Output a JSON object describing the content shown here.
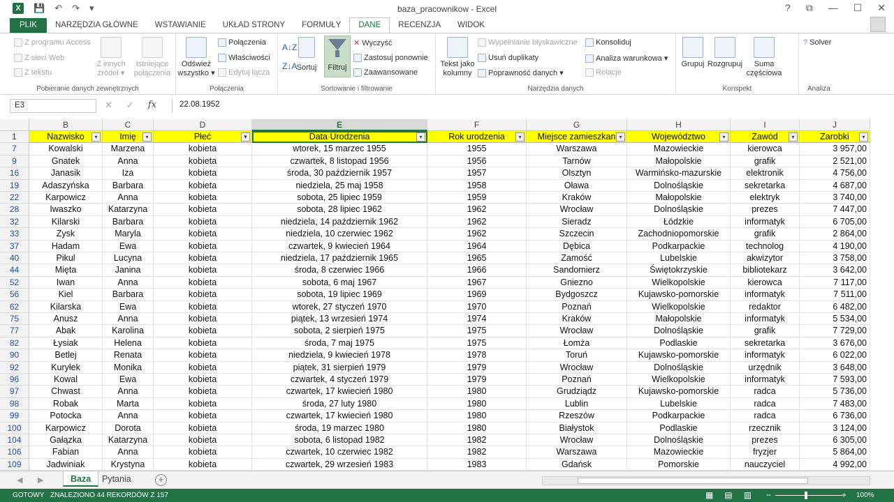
{
  "window": {
    "title": "baza_pracownikow - Excel",
    "logo": "X",
    "help": "?",
    "controls": [
      "⧉",
      "—",
      "☐",
      "✕"
    ]
  },
  "tabs": [
    "PLIK",
    "NARZĘDZIA GŁÓWNE",
    "WSTAWIANIE",
    "UKŁAD STRONY",
    "FORMUŁY",
    "DANE",
    "RECENZJA",
    "WIDOK"
  ],
  "active_tab": "DANE",
  "ribbon": {
    "external": {
      "access": "Z programu Access",
      "web": "Z sieci Web",
      "text": "Z tekstu",
      "other1": "Z innych",
      "other2": "źródeł ▾",
      "existing1": "Istniejące",
      "existing2": "połączenia",
      "label": "Pobieranie danych zewnętrznych"
    },
    "connections": {
      "refresh1": "Odśwież",
      "refresh2": "wszystko ▾",
      "conn": "Połączenia",
      "props": "Właściwości",
      "edit": "Edytuj łącza",
      "label": "Połączenia"
    },
    "sort": {
      "sort": "Sortuj",
      "filter": "Filtruj",
      "clear": "Wyczyść",
      "reapply": "Zastosuj ponownie",
      "advanced": "Zaawansowane",
      "label": "Sortowanie i filtrowanie"
    },
    "tools": {
      "text1": "Tekst jako",
      "text2": "kolumny",
      "flash": "Wypełnianie błyskawiczne",
      "dup": "Usuń duplikaty",
      "valid": "Poprawność danych ▾",
      "consol": "Konsoliduj",
      "whatif": "Analiza warunkowa ▾",
      "rel": "Relacje",
      "label": "Narzędzia danych"
    },
    "outline": {
      "group": "Grupuj",
      "ungroup": "Rozgrupuj",
      "subtotal1": "Suma",
      "subtotal2": "częściowa",
      "label": "Konspekt"
    },
    "analysis": {
      "solver": "Solver",
      "label": "Analiza"
    }
  },
  "formula_bar": {
    "name_box": "E3",
    "fx": "fx",
    "value": "22.08.1952"
  },
  "columns": [
    "B",
    "C",
    "D",
    "E",
    "F",
    "G",
    "H",
    "I",
    "J"
  ],
  "header_row_number": "1",
  "headers": [
    "Nazwisko",
    "Imię",
    "Płeć",
    "Data Urodzenia",
    "Rok urodzenia",
    "Miejsce zamieszkan",
    "Województwo",
    "Zawód",
    "Zarobki"
  ],
  "rows": [
    {
      "n": "7",
      "c": [
        "Kowalski",
        "Marzena",
        "kobieta",
        "wtorek, 15 marzec 1955",
        "1955",
        "Warszawa",
        "Mazowieckie",
        "kierowca",
        "3 957,00"
      ]
    },
    {
      "n": "9",
      "c": [
        "Gnatek",
        "Anna",
        "kobieta",
        "czwartek, 8 listopad 1956",
        "1956",
        "Tarnów",
        "Małopolskie",
        "grafik",
        "2 521,00"
      ]
    },
    {
      "n": "16",
      "c": [
        "Janasik",
        "Iza",
        "kobieta",
        "środa, 30 październik 1957",
        "1957",
        "Olsztyn",
        "Warmińsko-mazurskie",
        "elektronik",
        "4 756,00"
      ]
    },
    {
      "n": "19",
      "c": [
        "Adaszyńska",
        "Barbara",
        "kobieta",
        "niedziela, 25 maj 1958",
        "1958",
        "Oława",
        "Dolnośląskie",
        "sekretarka",
        "4 687,00"
      ]
    },
    {
      "n": "22",
      "c": [
        "Karpowicz",
        "Anna",
        "kobieta",
        "sobota, 25 lipiec 1959",
        "1959",
        "Kraków",
        "Małopolskie",
        "elektryk",
        "3 740,00"
      ]
    },
    {
      "n": "28",
      "c": [
        "Iwaszko",
        "Katarzyna",
        "kobieta",
        "sobota, 28 lipiec 1962",
        "1962",
        "Wrocław",
        "Dolnośląskie",
        "prezes",
        "7 447,00"
      ]
    },
    {
      "n": "32",
      "c": [
        "Kilarski",
        "Barbara",
        "kobieta",
        "niedziela, 14 październik 1962",
        "1962",
        "Sieradz",
        "Łódzkie",
        "informatyk",
        "6 705,00"
      ]
    },
    {
      "n": "33",
      "c": [
        "Zysk",
        "Maryla",
        "kobieta",
        "niedziela, 10 czerwiec 1962",
        "1962",
        "Szczecin",
        "Zachodniopomorskie",
        "grafik",
        "2 864,00"
      ]
    },
    {
      "n": "37",
      "c": [
        "Hadam",
        "Ewa",
        "kobieta",
        "czwartek, 9 kwiecień 1964",
        "1964",
        "Dębica",
        "Podkarpackie",
        "technolog",
        "4 190,00"
      ]
    },
    {
      "n": "40",
      "c": [
        "Pikul",
        "Lucyna",
        "kobieta",
        "niedziela, 17 październik 1965",
        "1965",
        "Zamość",
        "Lubelskie",
        "akwizytor",
        "3 758,00"
      ]
    },
    {
      "n": "44",
      "c": [
        "Mięta",
        "Janina",
        "kobieta",
        "środa, 8 czerwiec 1966",
        "1966",
        "Sandomierz",
        "Świętokrzyskie",
        "bibliotekarz",
        "3 642,00"
      ]
    },
    {
      "n": "52",
      "c": [
        "Iwan",
        "Anna",
        "kobieta",
        "sobota, 6 maj 1967",
        "1967",
        "Gniezno",
        "Wielkopolskie",
        "kierowca",
        "7 117,00"
      ]
    },
    {
      "n": "56",
      "c": [
        "Kiel",
        "Barbara",
        "kobieta",
        "sobota, 19 lipiec 1969",
        "1969",
        "Bydgoszcz",
        "Kujawsko-pomorskie",
        "informatyk",
        "7 511,00"
      ]
    },
    {
      "n": "62",
      "c": [
        "Kilarska",
        "Ewa",
        "kobieta",
        "wtorek, 27 styczeń 1970",
        "1970",
        "Poznań",
        "Wielkopolskie",
        "redaktor",
        "6 482,00"
      ]
    },
    {
      "n": "75",
      "c": [
        "Anusz",
        "Anna",
        "kobieta",
        "piątek, 13 wrzesień 1974",
        "1974",
        "Kraków",
        "Małopolskie",
        "informatyk",
        "5 534,00"
      ]
    },
    {
      "n": "77",
      "c": [
        "Abak",
        "Karolina",
        "kobieta",
        "sobota, 2 sierpień 1975",
        "1975",
        "Wrocław",
        "Dolnośląskie",
        "grafik",
        "7 729,00"
      ]
    },
    {
      "n": "82",
      "c": [
        "Łysiak",
        "Helena",
        "kobieta",
        "środa, 7 maj 1975",
        "1975",
        "Łomża",
        "Podlaskie",
        "sekretarka",
        "3 676,00"
      ]
    },
    {
      "n": "90",
      "c": [
        "Betlej",
        "Renata",
        "kobieta",
        "niedziela, 9 kwiecień 1978",
        "1978",
        "Toruń",
        "Kujawsko-pomorskie",
        "informatyk",
        "6 022,00"
      ]
    },
    {
      "n": "92",
      "c": [
        "Kuryłek",
        "Monika",
        "kobieta",
        "piątek, 31 sierpień 1979",
        "1979",
        "Wrocław",
        "Dolnośląskie",
        "urzędnik",
        "3 648,00"
      ]
    },
    {
      "n": "96",
      "c": [
        "Kowal",
        "Ewa",
        "kobieta",
        "czwartek, 4 styczeń 1979",
        "1979",
        "Poznań",
        "Wielkopolskie",
        "informatyk",
        "7 593,00"
      ]
    },
    {
      "n": "97",
      "c": [
        "Chwast",
        "Anna",
        "kobieta",
        "czwartek, 17 kwiecień 1980",
        "1980",
        "Grudziądz",
        "Kujawsko-pomorskie",
        "radca",
        "5 736,00"
      ]
    },
    {
      "n": "98",
      "c": [
        "Robak",
        "Marta",
        "kobieta",
        "środa, 27 luty 1980",
        "1980",
        "Lublin",
        "Lubelskie",
        "radca",
        "7 483,00"
      ]
    },
    {
      "n": "99",
      "c": [
        "Potocka",
        "Anna",
        "kobieta",
        "czwartek, 17 kwiecień 1980",
        "1980",
        "Rzeszów",
        "Podkarpackie",
        "radca",
        "6 736,00"
      ]
    },
    {
      "n": "100",
      "c": [
        "Karpowicz",
        "Dorota",
        "kobieta",
        "środa, 19 marzec 1980",
        "1980",
        "Białystok",
        "Podlaskie",
        "rzecznik",
        "3 124,00"
      ]
    },
    {
      "n": "104",
      "c": [
        "Gałązka",
        "Katarzyna",
        "kobieta",
        "sobota, 6 listopad 1982",
        "1982",
        "Wrocław",
        "Dolnośląskie",
        "prezes",
        "6 305,00"
      ]
    },
    {
      "n": "106",
      "c": [
        "Fabian",
        "Anna",
        "kobieta",
        "czwartek, 10 czerwiec 1982",
        "1982",
        "Warszawa",
        "Mazowieckie",
        "fryzjer",
        "5 864,00"
      ]
    },
    {
      "n": "109",
      "c": [
        "Jadwiniak",
        "Krystyna",
        "kobieta",
        "czwartek, 29 wrzesień 1983",
        "1983",
        "Gdańsk",
        "Pomorskie",
        "nauczyciel",
        "4 992,00"
      ]
    }
  ],
  "sheets": [
    "Baza",
    "Pytania"
  ],
  "active_sheet": "Baza",
  "status": {
    "ready": "GOTOWY",
    "found": "ZNALEZIONO 44 REKORDÓW Z 157",
    "zoom": "100%"
  },
  "colors": {
    "excel_green": "#217346",
    "header_fill": "#ffff00",
    "filtered_row_number": "#1f4fb4"
  }
}
